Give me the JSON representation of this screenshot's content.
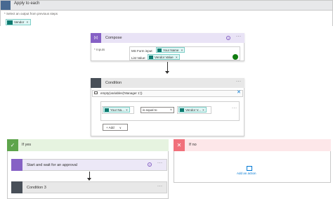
{
  "apply_to_each": {
    "title": "Apply to each",
    "prompt": "* Select an output from previous steps",
    "token": "Vendor",
    "token_close": "×"
  },
  "compose": {
    "title": "Compose",
    "help": "?",
    "more": "···",
    "icon_text": "{x}",
    "inputs_label": "* Inputs",
    "line1_text": "MS Form input:",
    "line1_token": "Your Name",
    "line2_text": "List Value:",
    "line2_token": "Vendor Value",
    "token_close": "×"
  },
  "condition": {
    "title": "Condition",
    "more": "···",
    "expression": "empty(variables('Manager 1'))",
    "close": "✕",
    "left_value": "Your Na...",
    "operator": "is equal to",
    "right_value": "Vendor V...",
    "token_close": "×",
    "row_more": "···",
    "add_label": "+ Add",
    "add_chevron": "∨"
  },
  "if_yes": {
    "title": "If yes",
    "check": "✓",
    "approval_title": "Start and wait for an approval",
    "approval_help": "?",
    "approval_more": "···",
    "condition3_title": "Condition 3",
    "condition3_more": "···"
  },
  "if_no": {
    "title": "If no",
    "x": "✕",
    "add_action": "Add an action"
  },
  "colors": {
    "compose_accent": "#8661c5",
    "condition_accent": "#484f58",
    "yes_accent": "#5ea54c",
    "no_accent": "#f1707b",
    "token_accent": "#0f7b70",
    "link": "#0078d4"
  }
}
